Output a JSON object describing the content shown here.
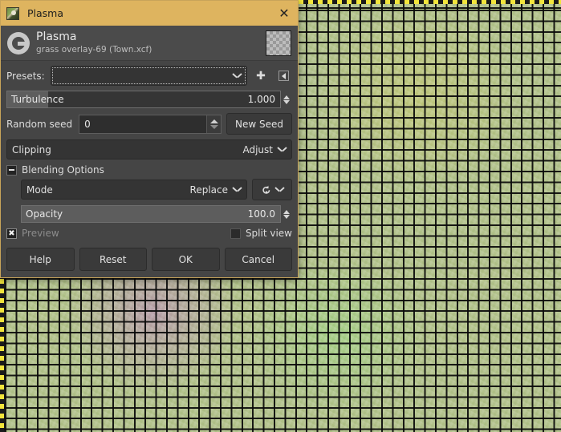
{
  "window": {
    "title": "Plasma",
    "icon": "image-thumbnail-icon",
    "close_label": "✕"
  },
  "header": {
    "logo": "gimp-wilber-icon",
    "title": "Plasma",
    "subtitle": "grass overlay-69 (Town.xcf)",
    "thumbnail": "checkerboard-transparency-thumbnail"
  },
  "presets": {
    "label": "Presets:",
    "value": "",
    "add_icon": "plus-icon",
    "menu_icon": "preset-menu-icon"
  },
  "turbulence": {
    "label": "Turbulence",
    "value": "1.000",
    "fill_percent": 15
  },
  "random_seed": {
    "label": "Random seed",
    "value": "0",
    "new_seed_label": "New Seed"
  },
  "clipping": {
    "label": "Clipping",
    "value": "Adjust"
  },
  "blending": {
    "label": "Blending Options",
    "expanded": true,
    "mode": {
      "label": "Mode",
      "value": "Replace"
    },
    "reset_icon": "reset-undo-icon",
    "opacity": {
      "label": "Opacity",
      "value": "100.0",
      "fill_percent": 100
    }
  },
  "options": {
    "preview_label": "Preview",
    "preview_checked": true,
    "preview_mark": "✖",
    "split_view_label": "Split view",
    "split_view_checked": false
  },
  "footer": {
    "help": "Help",
    "reset": "Reset",
    "ok": "OK",
    "cancel": "Cancel"
  },
  "colors": {
    "titlebar": "#deb45f",
    "dialog_bg": "#454545",
    "header_bg": "#4b4b4b",
    "accent_border": "#c8a45a",
    "canvas_edge": "#f2e53c"
  }
}
